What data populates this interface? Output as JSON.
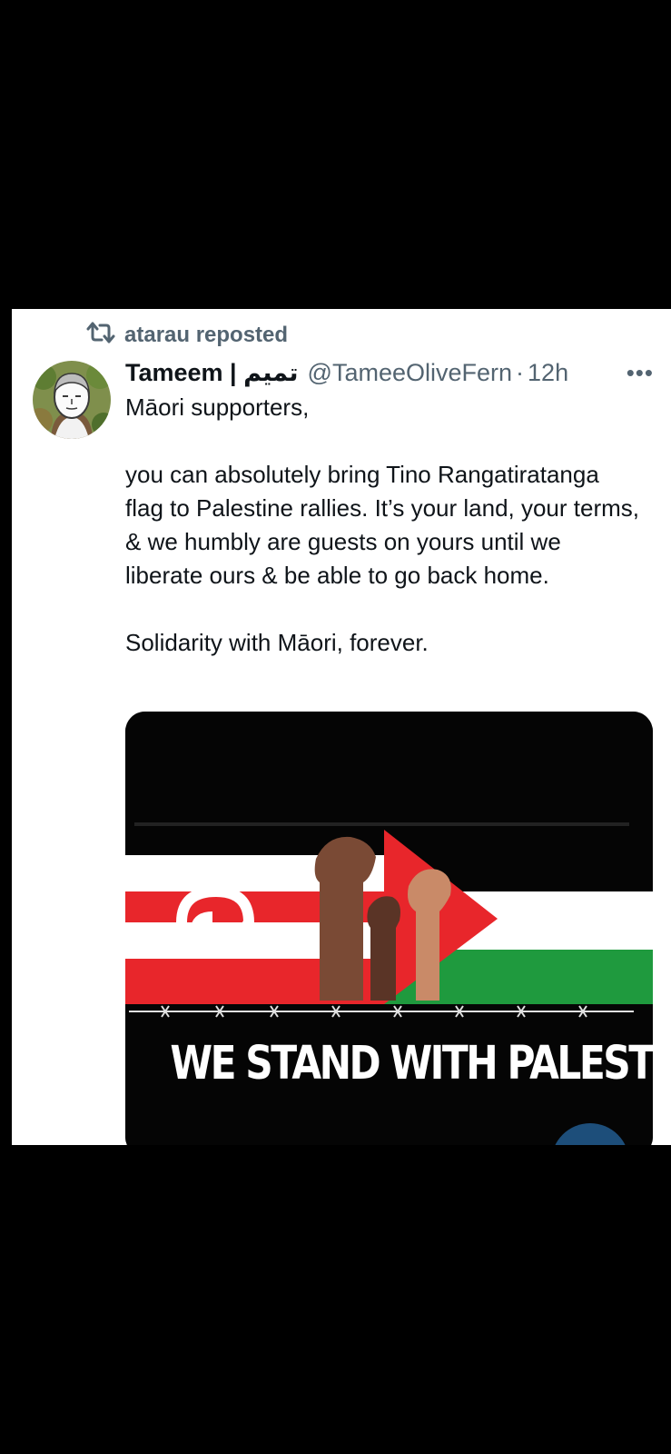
{
  "repost": {
    "label": "atarau reposted"
  },
  "post": {
    "display_name": "Tameem | تميم",
    "handle": "@TameeOliveFern",
    "separator": "·",
    "time": "12h",
    "more_label": "•••",
    "paragraphs": [
      "Māori supporters,",
      "you can absolutely bring Tino Rangatiratanga flag to Palestine rallies. It’s your land, your terms, & we humbly are guests on yours until we liberate ours & be able to go back home.",
      "Solidarity with Māori, forever."
    ]
  },
  "media": {
    "text": "WE STAND WITH PALESTINE"
  },
  "colors": {
    "red": "#e8262b",
    "green": "#1f9a3e",
    "muted": "#536471",
    "text": "#0f1419"
  },
  "icons": {
    "repost": "repost-icon",
    "more": "more-icon"
  }
}
